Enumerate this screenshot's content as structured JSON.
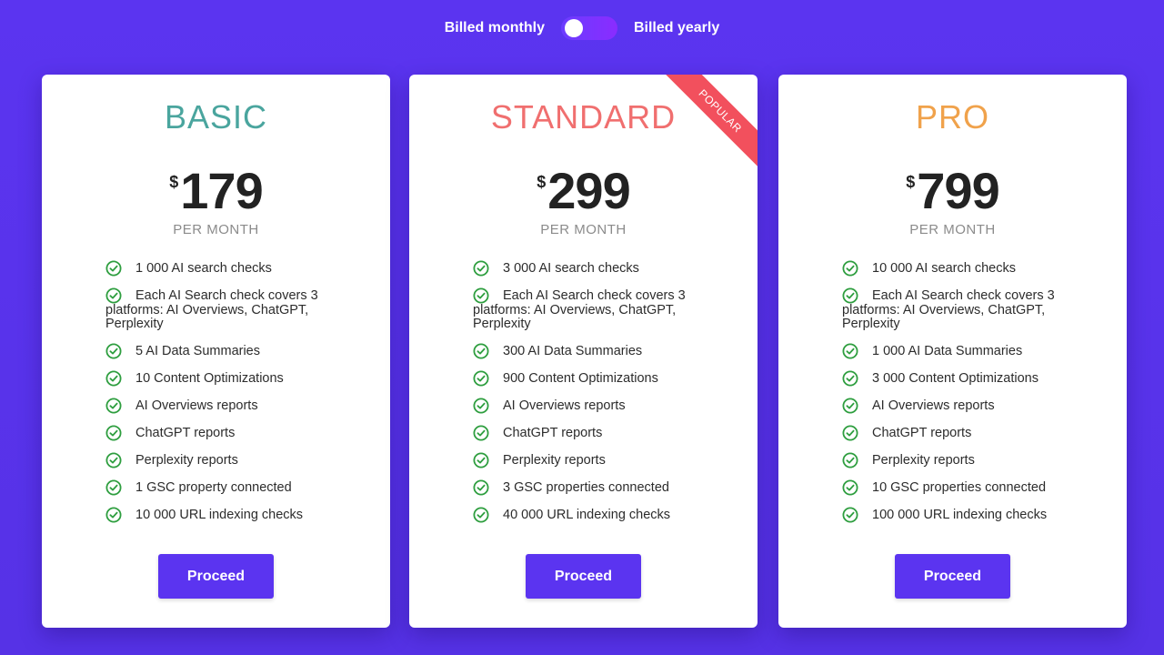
{
  "billing": {
    "monthly_label": "Billed monthly",
    "yearly_label": "Billed yearly",
    "selected": "monthly"
  },
  "colors": {
    "background": "#5b34f0",
    "basic": "#4aa59e",
    "standard": "#f06f6f",
    "pro": "#f0a24b",
    "check": "#2e9e3f",
    "button": "#5b34f0",
    "ribbon": "#f2505d"
  },
  "plans": [
    {
      "name": "BASIC",
      "currency": "$",
      "price": "179",
      "period": "PER MONTH",
      "features": [
        "1 000 AI search checks",
        "Each AI Search check covers 3 platforms: AI Overviews, ChatGPT, Perplexity",
        "5 AI Data Summaries",
        "10 Content Optimizations",
        "AI Overviews reports",
        "ChatGPT reports",
        "Perplexity reports",
        "1 GSC property connected",
        "10 000 URL indexing checks"
      ],
      "button": "Proceed"
    },
    {
      "name": "STANDARD",
      "badge": "POPULAR",
      "currency": "$",
      "price": "299",
      "period": "PER MONTH",
      "features": [
        "3 000 AI search checks",
        "Each AI Search check covers 3 platforms: AI Overviews, ChatGPT, Perplexity",
        "300 AI Data Summaries",
        "900 Content Optimizations",
        "AI Overviews reports",
        "ChatGPT reports",
        "Perplexity reports",
        "3 GSC properties connected",
        "40 000 URL indexing checks"
      ],
      "button": "Proceed"
    },
    {
      "name": "PRO",
      "currency": "$",
      "price": "799",
      "period": "PER MONTH",
      "features": [
        "10 000 AI search checks",
        "Each AI Search check covers 3 platforms: AI Overviews, ChatGPT, Perplexity",
        "1 000 AI Data Summaries",
        "3 000 Content Optimizations",
        "AI Overviews reports",
        "ChatGPT reports",
        "Perplexity reports",
        "10 GSC properties connected",
        "100 000 URL indexing checks"
      ],
      "button": "Proceed"
    }
  ]
}
